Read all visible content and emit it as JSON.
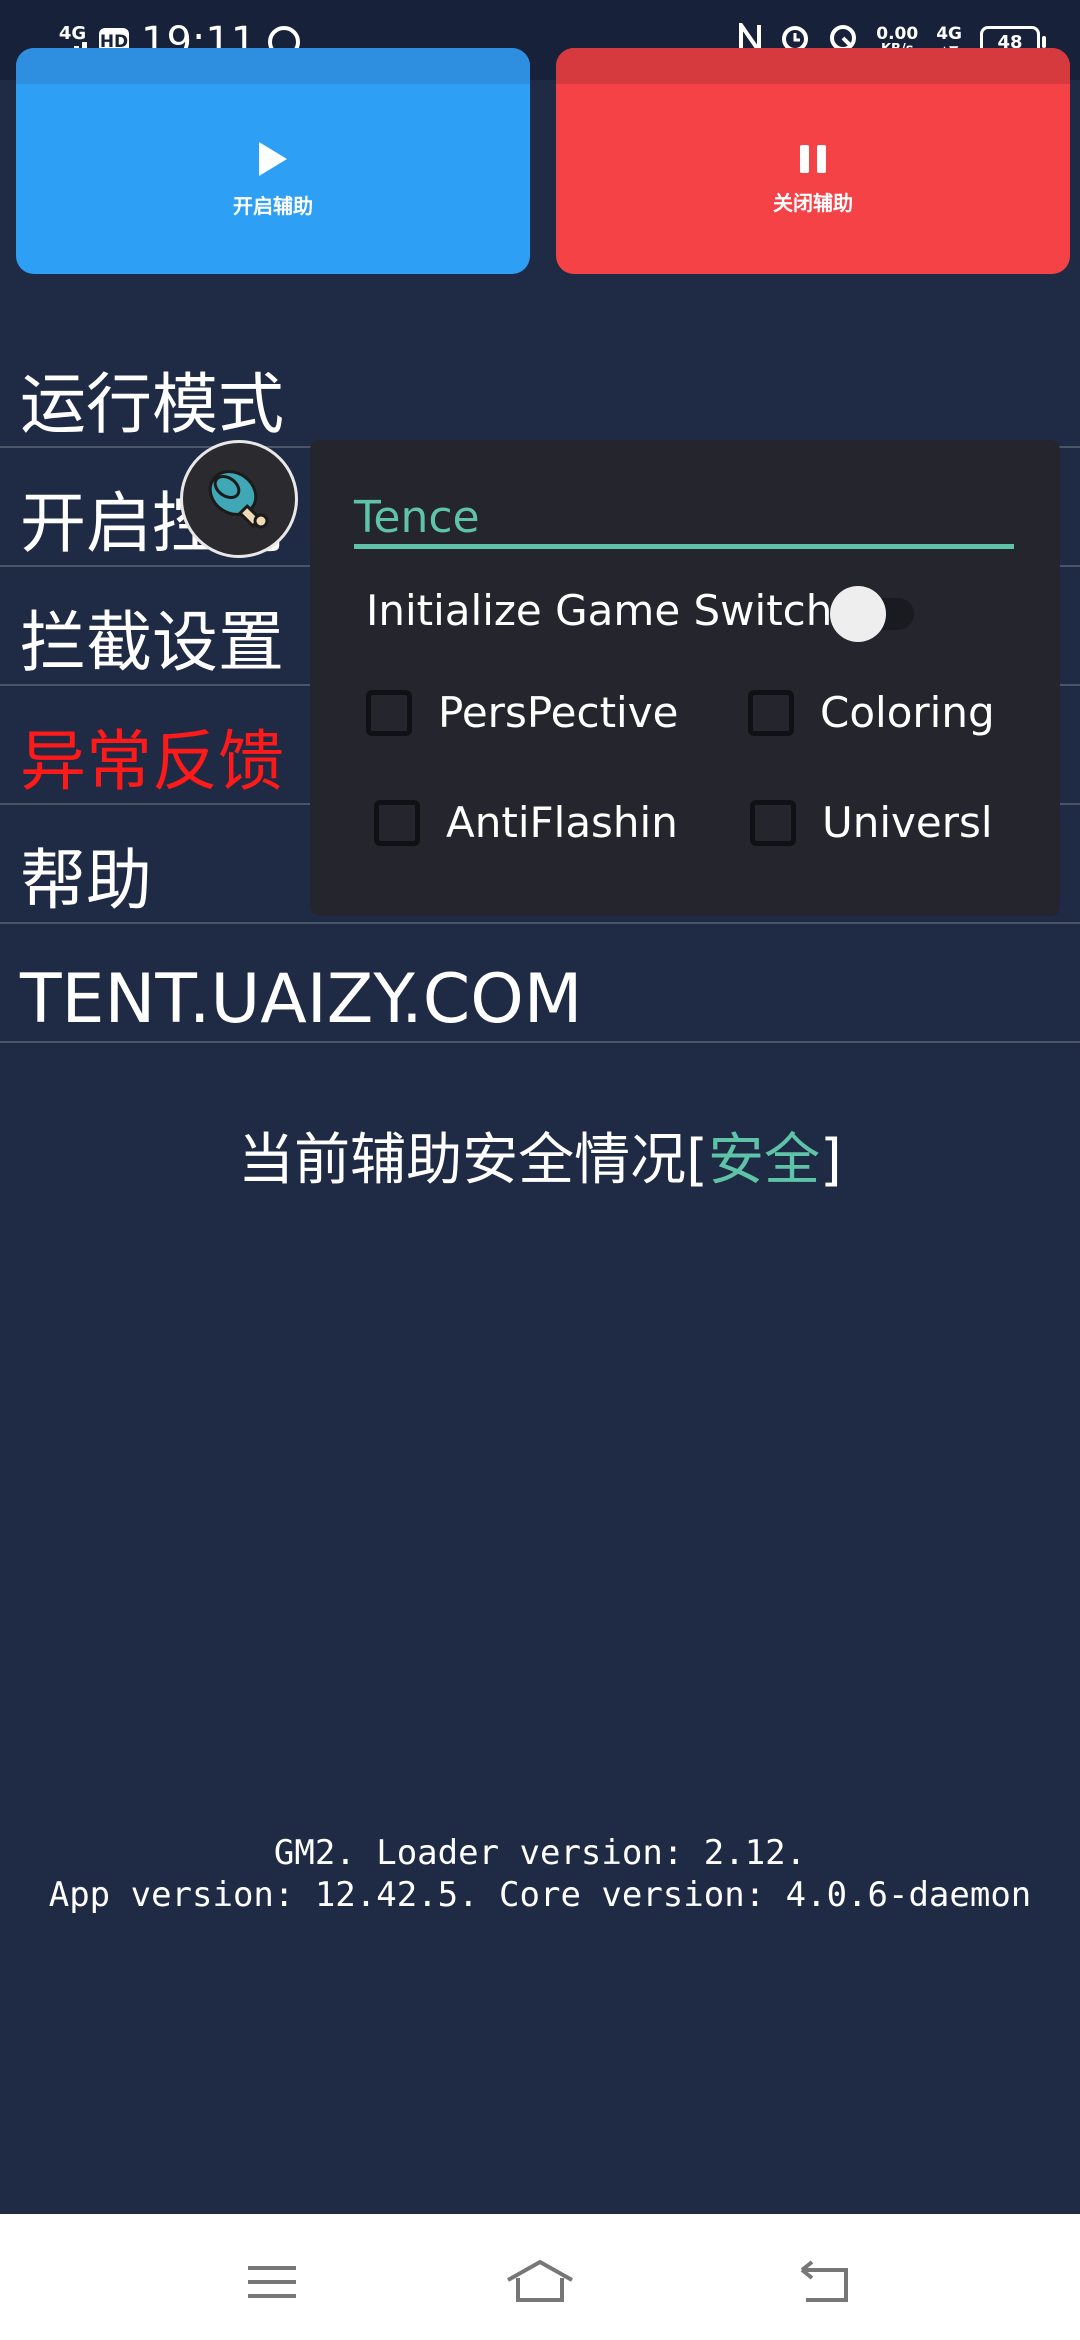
{
  "status_bar": {
    "network_left": "4G",
    "hd": "HD",
    "time": "19:11",
    "speed_value": "0.00",
    "speed_unit": "KB/s",
    "network_right": "4G",
    "battery": "48"
  },
  "buttons": {
    "start_label": "开启辅助",
    "stop_label": "关闭辅助"
  },
  "menu": {
    "items": [
      {
        "label": "运行模式"
      },
      {
        "label": "开启控制"
      },
      {
        "label": "拦截设置"
      },
      {
        "label": "异常反馈"
      },
      {
        "label": "帮助"
      },
      {
        "label": "TENT.UAIZY.COM"
      }
    ]
  },
  "panel": {
    "title": "Tence",
    "switch_label": "Initialize Game Switch",
    "switch_on": false,
    "checkboxes": [
      {
        "label": "PersPective",
        "checked": false
      },
      {
        "label": "Coloring",
        "checked": false
      },
      {
        "label": "AntiFlashin",
        "checked": false
      },
      {
        "label": "Universl",
        "checked": false
      }
    ]
  },
  "security": {
    "prefix": "当前辅助安全情况[",
    "status": "安全",
    "suffix": "]"
  },
  "version": {
    "line1": "GM2. Loader version: 2.12.",
    "line2": "App version: 12.42.5. Core version: 4.0.6-daemon"
  },
  "colors": {
    "background": "#1f2a44",
    "start_button": "#2d9ff5",
    "stop_button": "#f44246",
    "accent": "#5fc3a7",
    "warning_text": "#ff1a1a",
    "panel": "#24252d"
  },
  "icons": {
    "nav_menu": "menu-icon",
    "nav_home": "home-icon",
    "nav_back": "back-icon",
    "avatar": "meat-icon"
  }
}
